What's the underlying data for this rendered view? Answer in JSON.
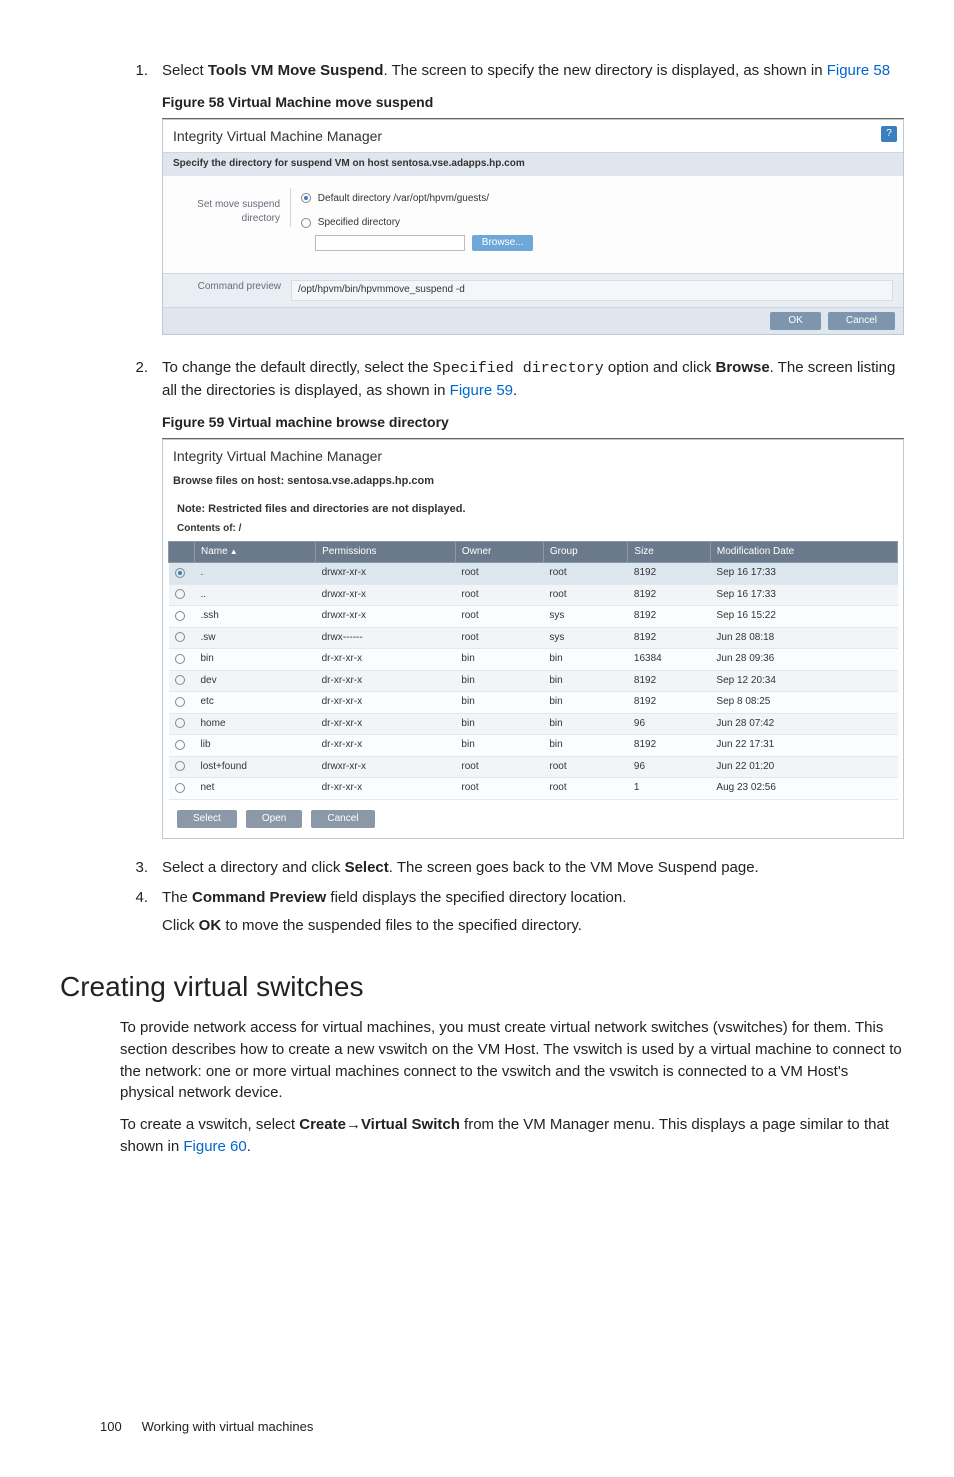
{
  "steps": {
    "s1_num": "1.",
    "s1_a": "Select ",
    "s1_b": "Tools VM Move Suspend",
    "s1_c": ". The screen to specify the new directory is displayed, as shown in ",
    "s1_link": "Figure 58",
    "s2_num": "2.",
    "s2_a": "To change the default directly, select the ",
    "s2_code": "Specified directory",
    "s2_b": " option and click ",
    "s2_bold": "Browse",
    "s2_c": ". The screen listing all the directories is displayed, as shown in ",
    "s2_link": "Figure 59",
    "s2_d": ".",
    "s3_num": "3.",
    "s3_a": "Select a directory and click ",
    "s3_bold": "Select",
    "s3_b": ". The screen goes back to the VM Move Suspend page.",
    "s4_num": "4.",
    "s4_a": "The ",
    "s4_bold": "Command Preview",
    "s4_b": " field displays the specified directory location.",
    "s4_line2a": "Click ",
    "s4_line2b": "OK",
    "s4_line2c": " to move the suspended files to the specified directory."
  },
  "fig58": {
    "caption": "Figure 58 Virtual Machine move suspend",
    "title": "Integrity Virtual Machine Manager",
    "help": "?",
    "sub": "Specify the directory for suspend VM on host sentosa.vse.adapps.hp.com",
    "leftlbl": "Set move suspend directory",
    "opt_default": "Default directory /var/opt/hpvm/guests/",
    "opt_spec": "Specified directory",
    "browse": "Browse...",
    "cmdprev_lbl": "Command preview",
    "cmdprev_val": "/opt/hpvm/bin/hpvmmove_suspend -d",
    "ok": "OK",
    "cancel": "Cancel"
  },
  "fig59": {
    "caption": "Figure 59 Virtual machine browse directory",
    "title": "Integrity Virtual Machine Manager",
    "sub1": "Browse files on host: sentosa.vse.adapps.hp.com",
    "note": "Note: Restricted files and directories are not displayed.",
    "contents": "Contents of: /",
    "headers": {
      "name": "Name",
      "perm": "Permissions",
      "owner": "Owner",
      "group": "Group",
      "size": "Size",
      "mod": "Modification Date"
    },
    "rows": [
      {
        "sel": true,
        "name": ".",
        "perm": "drwxr-xr-x",
        "owner": "root",
        "group": "root",
        "size": "8192",
        "mod": "Sep 16 17:33"
      },
      {
        "sel": false,
        "name": "..",
        "perm": "drwxr-xr-x",
        "owner": "root",
        "group": "root",
        "size": "8192",
        "mod": "Sep 16 17:33"
      },
      {
        "sel": false,
        "name": ".ssh",
        "perm": "drwxr-xr-x",
        "owner": "root",
        "group": "sys",
        "size": "8192",
        "mod": "Sep 16 15:22"
      },
      {
        "sel": false,
        "name": ".sw",
        "perm": "drwx------",
        "owner": "root",
        "group": "sys",
        "size": "8192",
        "mod": "Jun 28 08:18"
      },
      {
        "sel": false,
        "name": "bin",
        "perm": "dr-xr-xr-x",
        "owner": "bin",
        "group": "bin",
        "size": "16384",
        "mod": "Jun 28 09:36"
      },
      {
        "sel": false,
        "name": "dev",
        "perm": "dr-xr-xr-x",
        "owner": "bin",
        "group": "bin",
        "size": "8192",
        "mod": "Sep 12 20:34"
      },
      {
        "sel": false,
        "name": "etc",
        "perm": "dr-xr-xr-x",
        "owner": "bin",
        "group": "bin",
        "size": "8192",
        "mod": "Sep 8 08:25"
      },
      {
        "sel": false,
        "name": "home",
        "perm": "dr-xr-xr-x",
        "owner": "bin",
        "group": "bin",
        "size": "96",
        "mod": "Jun 28 07:42"
      },
      {
        "sel": false,
        "name": "lib",
        "perm": "dr-xr-xr-x",
        "owner": "bin",
        "group": "bin",
        "size": "8192",
        "mod": "Jun 22 17:31"
      },
      {
        "sel": false,
        "name": "lost+found",
        "perm": "drwxr-xr-x",
        "owner": "root",
        "group": "root",
        "size": "96",
        "mod": "Jun 22 01:20"
      },
      {
        "sel": false,
        "name": "net",
        "perm": "dr-xr-xr-x",
        "owner": "root",
        "group": "root",
        "size": "1",
        "mod": "Aug 23 02:56"
      }
    ],
    "select": "Select",
    "open": "Open",
    "cancel": "Cancel"
  },
  "section": {
    "heading": "Creating virtual switches",
    "p1": "To provide network access for virtual machines, you must create virtual network switches (vswitches) for them. This section describes how to create a new vswitch on the VM Host. The vswitch is used by a virtual machine to connect to the network: one or more virtual machines connect to the vswitch and the vswitch is connected to a VM Host's physical network device.",
    "p2_a": "To create a vswitch, select ",
    "p2_b": "Create",
    "p2_arrow": "→",
    "p2_c": "Virtual Switch",
    "p2_d": " from the VM Manager menu. This displays a page similar to that shown in ",
    "p2_link": "Figure 60",
    "p2_e": "."
  },
  "footer": {
    "page": "100",
    "title": "Working with virtual machines"
  }
}
